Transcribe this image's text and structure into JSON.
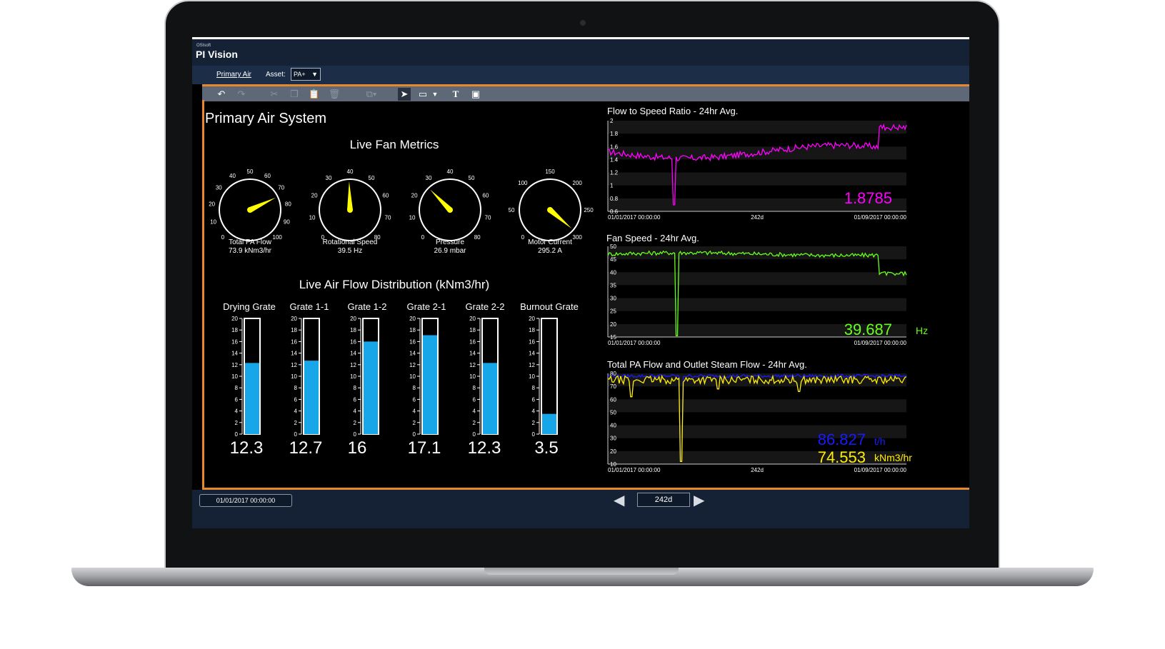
{
  "app": {
    "vendor": "OSIsoft",
    "name": "PI Vision"
  },
  "nav": {
    "display_link": "Primary Air",
    "asset_label": "Asset:",
    "asset_value": "PA+"
  },
  "colors": {
    "accent": "#e8882c",
    "header_bg": "#152235",
    "nav_bg": "#1c2e47",
    "bar_fill": "#17a7e8",
    "needle": "#ffff00",
    "trend1": "#ff00ff",
    "trend2": "#66ff1a",
    "trend3a": "#1a1aff",
    "trend3b": "#ffee00"
  },
  "toolbar": {
    "icons": [
      "undo-icon",
      "redo-icon",
      "cut-icon",
      "copy-icon",
      "paste-icon",
      "delete-icon",
      "arrange-icon",
      "select-pointer-icon",
      "rectangle-icon",
      "shape-dropdown-icon",
      "text-icon",
      "image-icon"
    ]
  },
  "page_title": "Primary Air System",
  "gauges_section": {
    "title": "Live Fan Metrics"
  },
  "gauges": [
    {
      "label": "Total PA Flow",
      "value_text": "73.9 kNm3/hr",
      "value": 73.9,
      "min": 0,
      "max": 100,
      "ticks": [
        "0",
        "10",
        "20",
        "30",
        "40",
        "50",
        "60",
        "70",
        "80",
        "90",
        "100"
      ]
    },
    {
      "label": "Rotational Speed",
      "value_text": "39.5 Hz",
      "value": 39.5,
      "min": 0,
      "max": 80,
      "ticks": [
        "0",
        "10",
        "20",
        "30",
        "40",
        "50",
        "60",
        "70",
        "80"
      ]
    },
    {
      "label": "Pressure",
      "value_text": "26.9 mbar",
      "value": 26.9,
      "min": 0,
      "max": 80,
      "ticks": [
        "0",
        "10",
        "20",
        "30",
        "40",
        "50",
        "60",
        "70",
        "80"
      ]
    },
    {
      "label": "Motor Current",
      "value_text": "295.2 A",
      "value": 295.2,
      "min": 0,
      "max": 300,
      "ticks": [
        "0",
        "50",
        "100",
        "150",
        "200",
        "250",
        "300"
      ]
    }
  ],
  "bars_section": {
    "title": "Live Air Flow Distribution (kNm3/hr)"
  },
  "bars": [
    {
      "label": "Drying Grate",
      "value": 12.3,
      "value_text": "12.3"
    },
    {
      "label": "Grate 1-1",
      "value": 12.7,
      "value_text": "12.7"
    },
    {
      "label": "Grate 1-2",
      "value": 16,
      "value_text": "16"
    },
    {
      "label": "Grate 2-1",
      "value": 17.1,
      "value_text": "17.1"
    },
    {
      "label": "Grate 2-2",
      "value": 12.3,
      "value_text": "12.3"
    },
    {
      "label": "Burnout Grate",
      "value": 3.5,
      "value_text": "3.5"
    }
  ],
  "bar_scale": {
    "min": 0,
    "max": 20,
    "ticks": [
      "0",
      "2",
      "4",
      "6",
      "8",
      "10",
      "12",
      "14",
      "16",
      "18",
      "20"
    ]
  },
  "trends": [
    {
      "title": "Flow to Speed Ratio - 24hr Avg.",
      "y_ticks": [
        "2",
        "1.8",
        "1.6",
        "1.4",
        "1.2",
        "1",
        "0.8",
        "0.6"
      ],
      "ylim": [
        0.6,
        2
      ],
      "start": "01/01/2017 00:00:00",
      "mid": "242d",
      "end": "01/09/2017 00:00:00",
      "series": [
        {
          "color": "#ff00ff",
          "readout": "1.8785",
          "unit": ""
        }
      ]
    },
    {
      "title": "Fan Speed - 24hr Avg.",
      "y_ticks": [
        "50",
        "45",
        "40",
        "35",
        "30",
        "25",
        "20",
        "15"
      ],
      "ylim": [
        15,
        50
      ],
      "start": "01/01/2017 00:00:00",
      "mid": "",
      "end": "01/09/2017 00:00:00",
      "series": [
        {
          "color": "#66ff1a",
          "readout": "39.687",
          "unit": "Hz"
        }
      ]
    },
    {
      "title": "Total PA Flow and Outlet Steam Flow - 24hr Avg.",
      "y_ticks": [
        "80",
        "70",
        "60",
        "50",
        "40",
        "30",
        "20",
        "10"
      ],
      "ylim": [
        10,
        80
      ],
      "start": "01/01/2017 00:00:00",
      "mid": "242d",
      "end": "01/09/2017 00:00:00",
      "series": [
        {
          "color": "#1a1aff",
          "readout": "86.827",
          "unit": "t/h"
        },
        {
          "color": "#ffee00",
          "readout": "74.553",
          "unit": "kNm3/hr"
        }
      ]
    }
  ],
  "timebar": {
    "start": "01/01/2017 00:00:00",
    "duration": "242d",
    "back_arrow": "◀",
    "forward_arrow": "▶"
  }
}
